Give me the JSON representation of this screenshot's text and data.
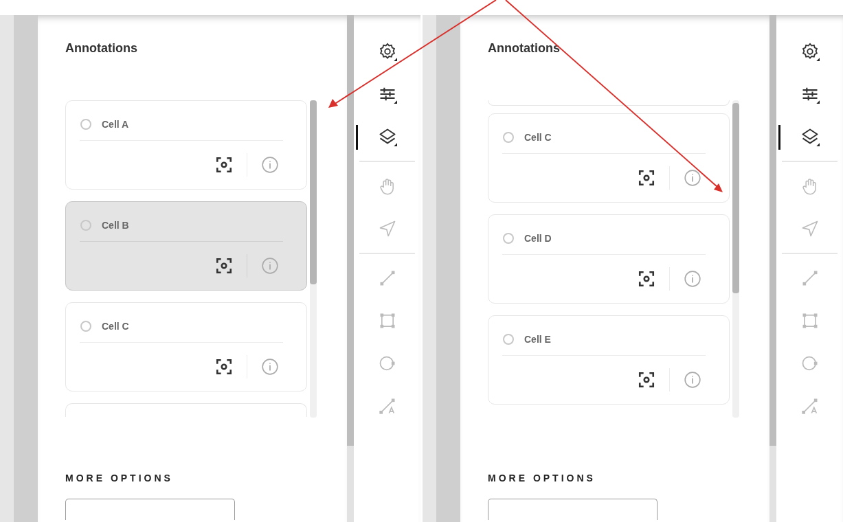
{
  "panels": [
    {
      "title": "Annotations",
      "partial_card_above": false,
      "partial_card_below": true,
      "cards": [
        {
          "label": "Cell A",
          "selected": false
        },
        {
          "label": "Cell B",
          "selected": true
        },
        {
          "label": "Cell C",
          "selected": false
        }
      ],
      "section_heading": "MORE OPTIONS",
      "tools": [
        {
          "kind": "settings",
          "selected": false
        },
        {
          "kind": "sliders",
          "selected": false
        },
        {
          "kind": "layers",
          "selected": true
        },
        {
          "kind": "divider"
        },
        {
          "kind": "hand",
          "selected": false
        },
        {
          "kind": "pointer",
          "selected": false
        },
        {
          "kind": "divider"
        },
        {
          "kind": "line",
          "selected": false
        },
        {
          "kind": "rectangle",
          "selected": false
        },
        {
          "kind": "circle",
          "selected": false
        },
        {
          "kind": "line-text",
          "selected": false
        }
      ]
    },
    {
      "title": "Annotations",
      "partial_card_above": true,
      "partial_card_below": false,
      "cards": [
        {
          "label": "Cell C",
          "selected": false
        },
        {
          "label": "Cell D",
          "selected": false
        },
        {
          "label": "Cell E",
          "selected": false
        }
      ],
      "section_heading": "MORE OPTIONS",
      "tools": [
        {
          "kind": "settings",
          "selected": false
        },
        {
          "kind": "sliders",
          "selected": false
        },
        {
          "kind": "layers",
          "selected": true
        },
        {
          "kind": "divider"
        },
        {
          "kind": "hand",
          "selected": false
        },
        {
          "kind": "pointer",
          "selected": false
        },
        {
          "kind": "divider"
        },
        {
          "kind": "line",
          "selected": false
        },
        {
          "kind": "rectangle",
          "selected": false
        },
        {
          "kind": "circle",
          "selected": false
        },
        {
          "kind": "line-text",
          "selected": false
        }
      ]
    }
  ]
}
